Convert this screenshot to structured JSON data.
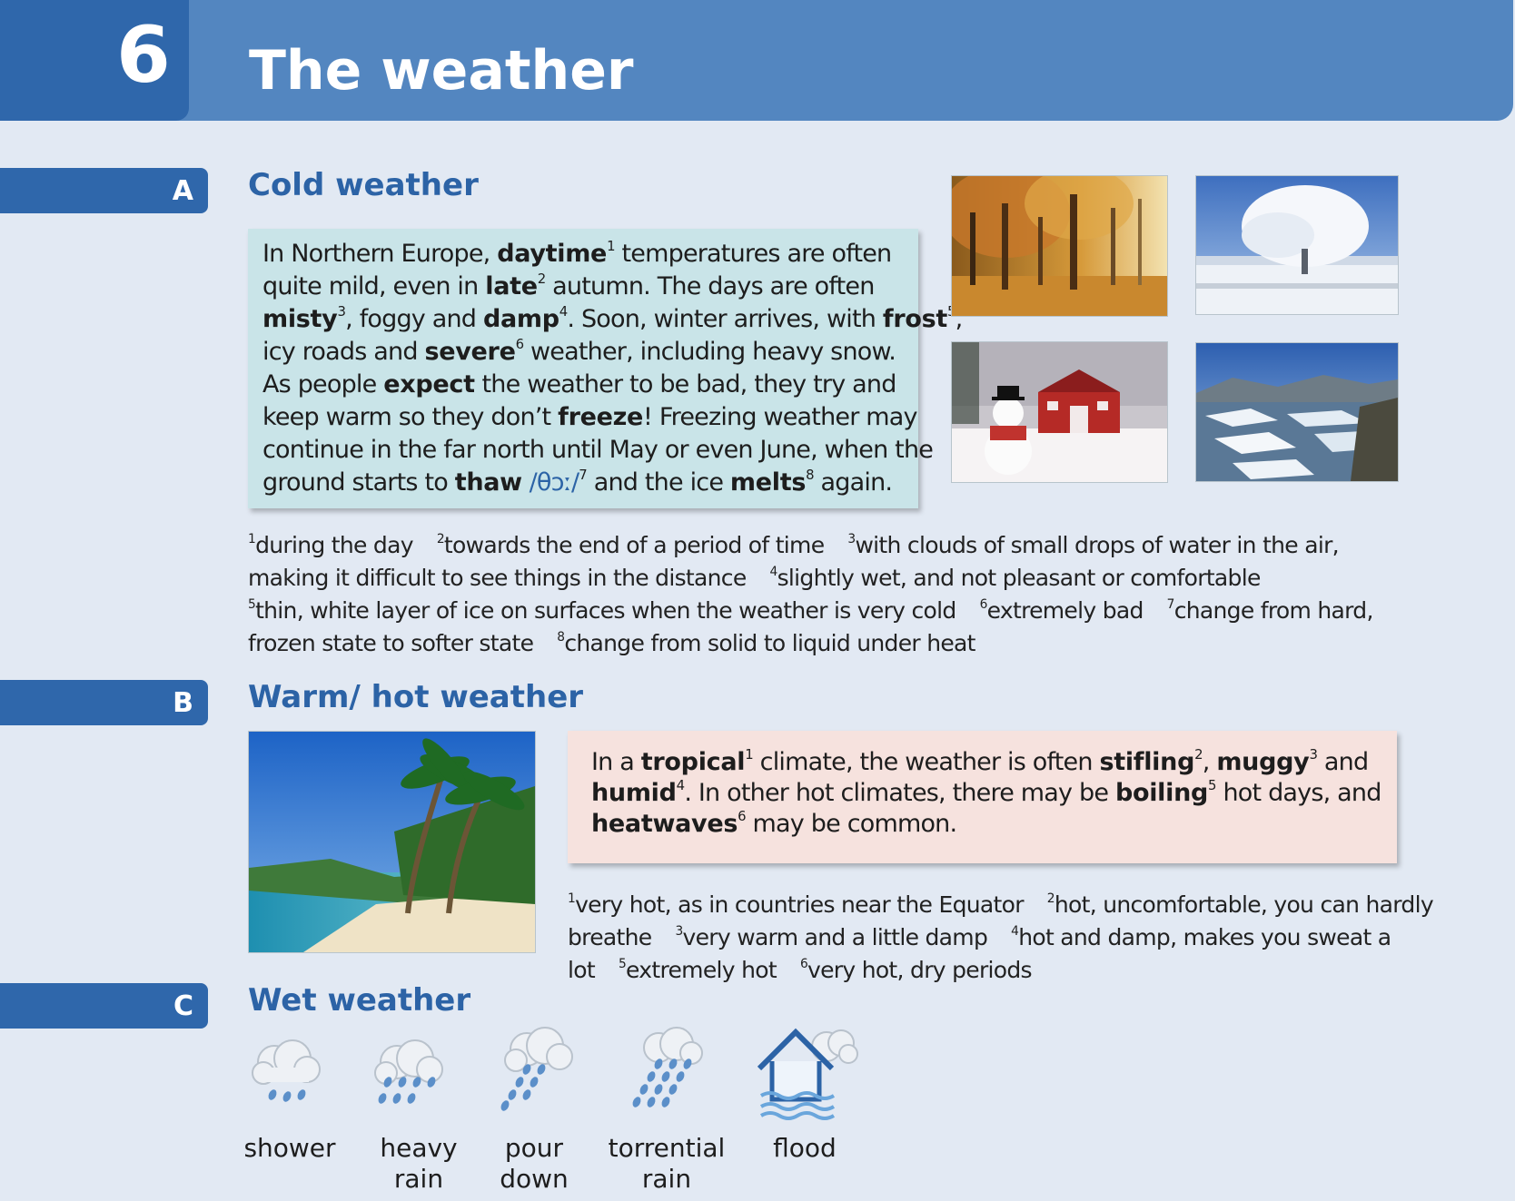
{
  "unit": {
    "number": "6",
    "title": "The weather"
  },
  "sections": {
    "a": {
      "letter": "A",
      "title": "Cold weather",
      "glosses": [
        "during the day",
        "towards the end of a period of time",
        "with clouds of small drops of water in the air, making it difficult to see things in the distance",
        "slightly wet, and not pleasant or comfortable",
        "thin, white layer of ice on surfaces when the weather is very cold",
        "extremely bad",
        "change from hard, frozen state to softer state",
        "change from solid to liquid under heat"
      ],
      "photos": [
        "autumn-forest-photo",
        "frosty-tree-photo",
        "snowman-barn-photo",
        "melting-ice-photo"
      ]
    },
    "b": {
      "letter": "B",
      "title": "Warm/ hot weather",
      "glosses": [
        "very hot, as in countries near the Equator",
        "hot, uncomfortable, you can hardly breathe",
        "very warm and a little damp",
        "hot and damp, makes you sweat a lot",
        "extremely hot",
        "very hot, dry periods"
      ],
      "photos": [
        "tropical-beach-photo"
      ]
    },
    "c": {
      "letter": "C",
      "title": "Wet weather",
      "icons": [
        {
          "icon": "shower-cloud-icon",
          "label_1": "shower",
          "label_2": ""
        },
        {
          "icon": "heavy-rain-cloud-icon",
          "label_1": "heavy",
          "label_2": "rain"
        },
        {
          "icon": "pour-down-cloud-icon",
          "label_1": "pour",
          "label_2": "down"
        },
        {
          "icon": "torrential-rain-cloud-icon",
          "label_1": "torrential",
          "label_2": "rain"
        },
        {
          "icon": "flood-house-icon",
          "label_1": "flood",
          "label_2": ""
        }
      ]
    }
  },
  "para_a": {
    "l1_pre": "In Northern Europe, ",
    "w1": "daytime",
    "n1": "1",
    "l1_post": " temperatures are often",
    "l2_pre": "quite mild, even in ",
    "w2": "late",
    "n2": "2",
    "l2_post": " autumn. The days are often",
    "w3": "misty",
    "n3": "3",
    "l3_mid1": ", foggy and ",
    "w4": "damp",
    "n4": "4",
    "l3_mid2": ". Soon, winter arrives, with ",
    "w5": "frost",
    "n5": "5",
    "l3_end": ",",
    "l4_pre": "icy roads and ",
    "w6": "severe",
    "n6": "6",
    "l4_post": " weather, including heavy snow.",
    "l5_pre": "As people ",
    "w_expect": "expect",
    "l5_post": " the weather to be bad, they try and",
    "l6_pre": "keep warm so they don’t ",
    "w_freeze": "freeze",
    "l6_post": "! Freezing weather may",
    "l7": "continue in the far north until May or even June, when the",
    "l8_pre": "ground starts to ",
    "w7": "thaw",
    "ipa": " /θɔː/",
    "n7": "7",
    "l8_mid": " and the ice ",
    "w8": "melts",
    "n8": "8",
    "l8_post": " again."
  },
  "para_b": {
    "l1_pre": "In a ",
    "w1": "tropical",
    "n1": "1",
    "l1_mid": " climate, the weather is often ",
    "w2": "stifling",
    "n2": "2",
    "l1_comma": ", ",
    "w3": "muggy",
    "n3": "3",
    "l1_post": " and",
    "w4": "humid",
    "n4": "4",
    "l2_mid": ". In other hot climates, there may be ",
    "w5": "boiling",
    "n5": "5",
    "l2_post": " hot days, and",
    "w6": "heatwaves",
    "n6": "6",
    "l3_post": " may be common."
  },
  "gloss_a_lines": [
    [
      {
        "n": "1",
        "t": "during the day"
      },
      {
        "n": "2",
        "t": "towards the end of a period of time"
      },
      {
        "n": "3",
        "t": "with clouds of small drops of water in the air,"
      }
    ],
    [
      {
        "n": "",
        "t": "making it difficult to see things in the distance"
      },
      {
        "n": "4",
        "t": "slightly wet, and not pleasant or comfortable"
      }
    ],
    [
      {
        "n": "5",
        "t": "thin, white layer of ice on surfaces when the weather is very cold"
      },
      {
        "n": "6",
        "t": "extremely bad"
      },
      {
        "n": "7",
        "t": "change from hard,"
      }
    ],
    [
      {
        "n": "",
        "t": "frozen state to softer state"
      },
      {
        "n": "8",
        "t": "change from solid to liquid under heat"
      }
    ]
  ],
  "gloss_b_lines": [
    [
      {
        "n": "1",
        "t": "very hot, as in countries near the Equator"
      },
      {
        "n": "2",
        "t": "hot, uncomfortable, you can hardly"
      }
    ],
    [
      {
        "n": "",
        "t": "breathe"
      },
      {
        "n": "3",
        "t": "very warm and a little damp"
      },
      {
        "n": "4",
        "t": "hot and damp, makes you sweat a"
      }
    ],
    [
      {
        "n": "",
        "t": "lot"
      },
      {
        "n": "5",
        "t": "extremely hot"
      },
      {
        "n": "6",
        "t": "very hot, dry periods"
      }
    ]
  ],
  "colors": {
    "page_bg": "#e2e9f3",
    "header_blue": "#5386c0",
    "accent_blue": "#2c63a6",
    "box_a_bg": "#c9e4e8",
    "box_b_bg": "#f6e2de"
  }
}
